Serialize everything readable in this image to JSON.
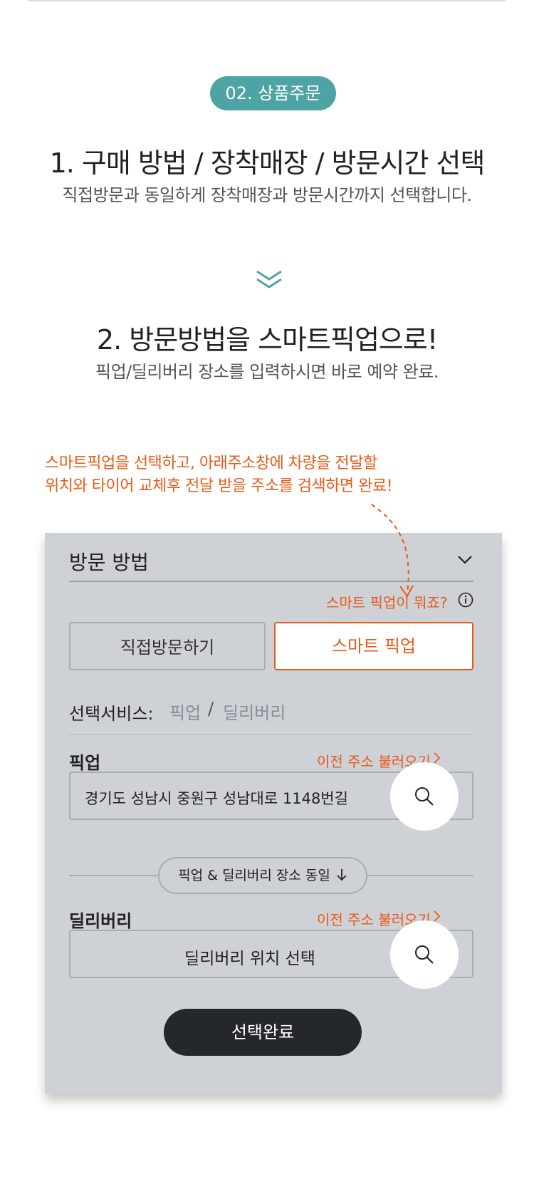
{
  "step_badge": "02. 상품주문",
  "step1": {
    "title": "1. 구매 방법 / 장착매장 / 방문시간 선택",
    "desc": "직접방문과 동일하게 장착매장과 방문시간까지 선택합니다."
  },
  "step2": {
    "title": "2. 방문방법을 스마트픽업으로!",
    "desc": "픽업/딜리버리 장소를 입력하시면 바로 예약 완료."
  },
  "note": {
    "line1": "스마트픽업을 선택하고, 아래주소창에 차량을 전달할",
    "line2": "위치와 타이어 교체후 전달 받을 주소를 검색하면 완료!"
  },
  "card": {
    "visit_method_title": "방문 방법",
    "what_is_smart": "스마트 픽업이 뭐죠?",
    "btn_direct": "직접방문하기",
    "btn_smart": "스마트 픽업",
    "service_label": "선택서비스:",
    "service_opt1": "픽업",
    "service_sep": "/",
    "service_opt2": "딜리버리",
    "pickup_title": "픽업",
    "prev_address": "이전 주소 불러오기",
    "pickup_value": "경기도 성남시 중원구 성남대로 1148번길",
    "same_place": "픽업 & 딜리버리 장소 동일",
    "delivery_title": "딜리버리",
    "prev_address2": "이전 주소 불러오기",
    "delivery_placeholder": "딜리버리 위치 선택",
    "done": "선택완료"
  },
  "colors": {
    "accent": "#ea5a17",
    "teal": "#4ea3a5",
    "card_bg": "#ced1d6",
    "dark": "#24282c"
  },
  "icons": [
    "chevrons-down-icon",
    "chevron-down-icon",
    "info-icon",
    "chevron-right-icon",
    "search-icon",
    "arrow-down-icon"
  ]
}
